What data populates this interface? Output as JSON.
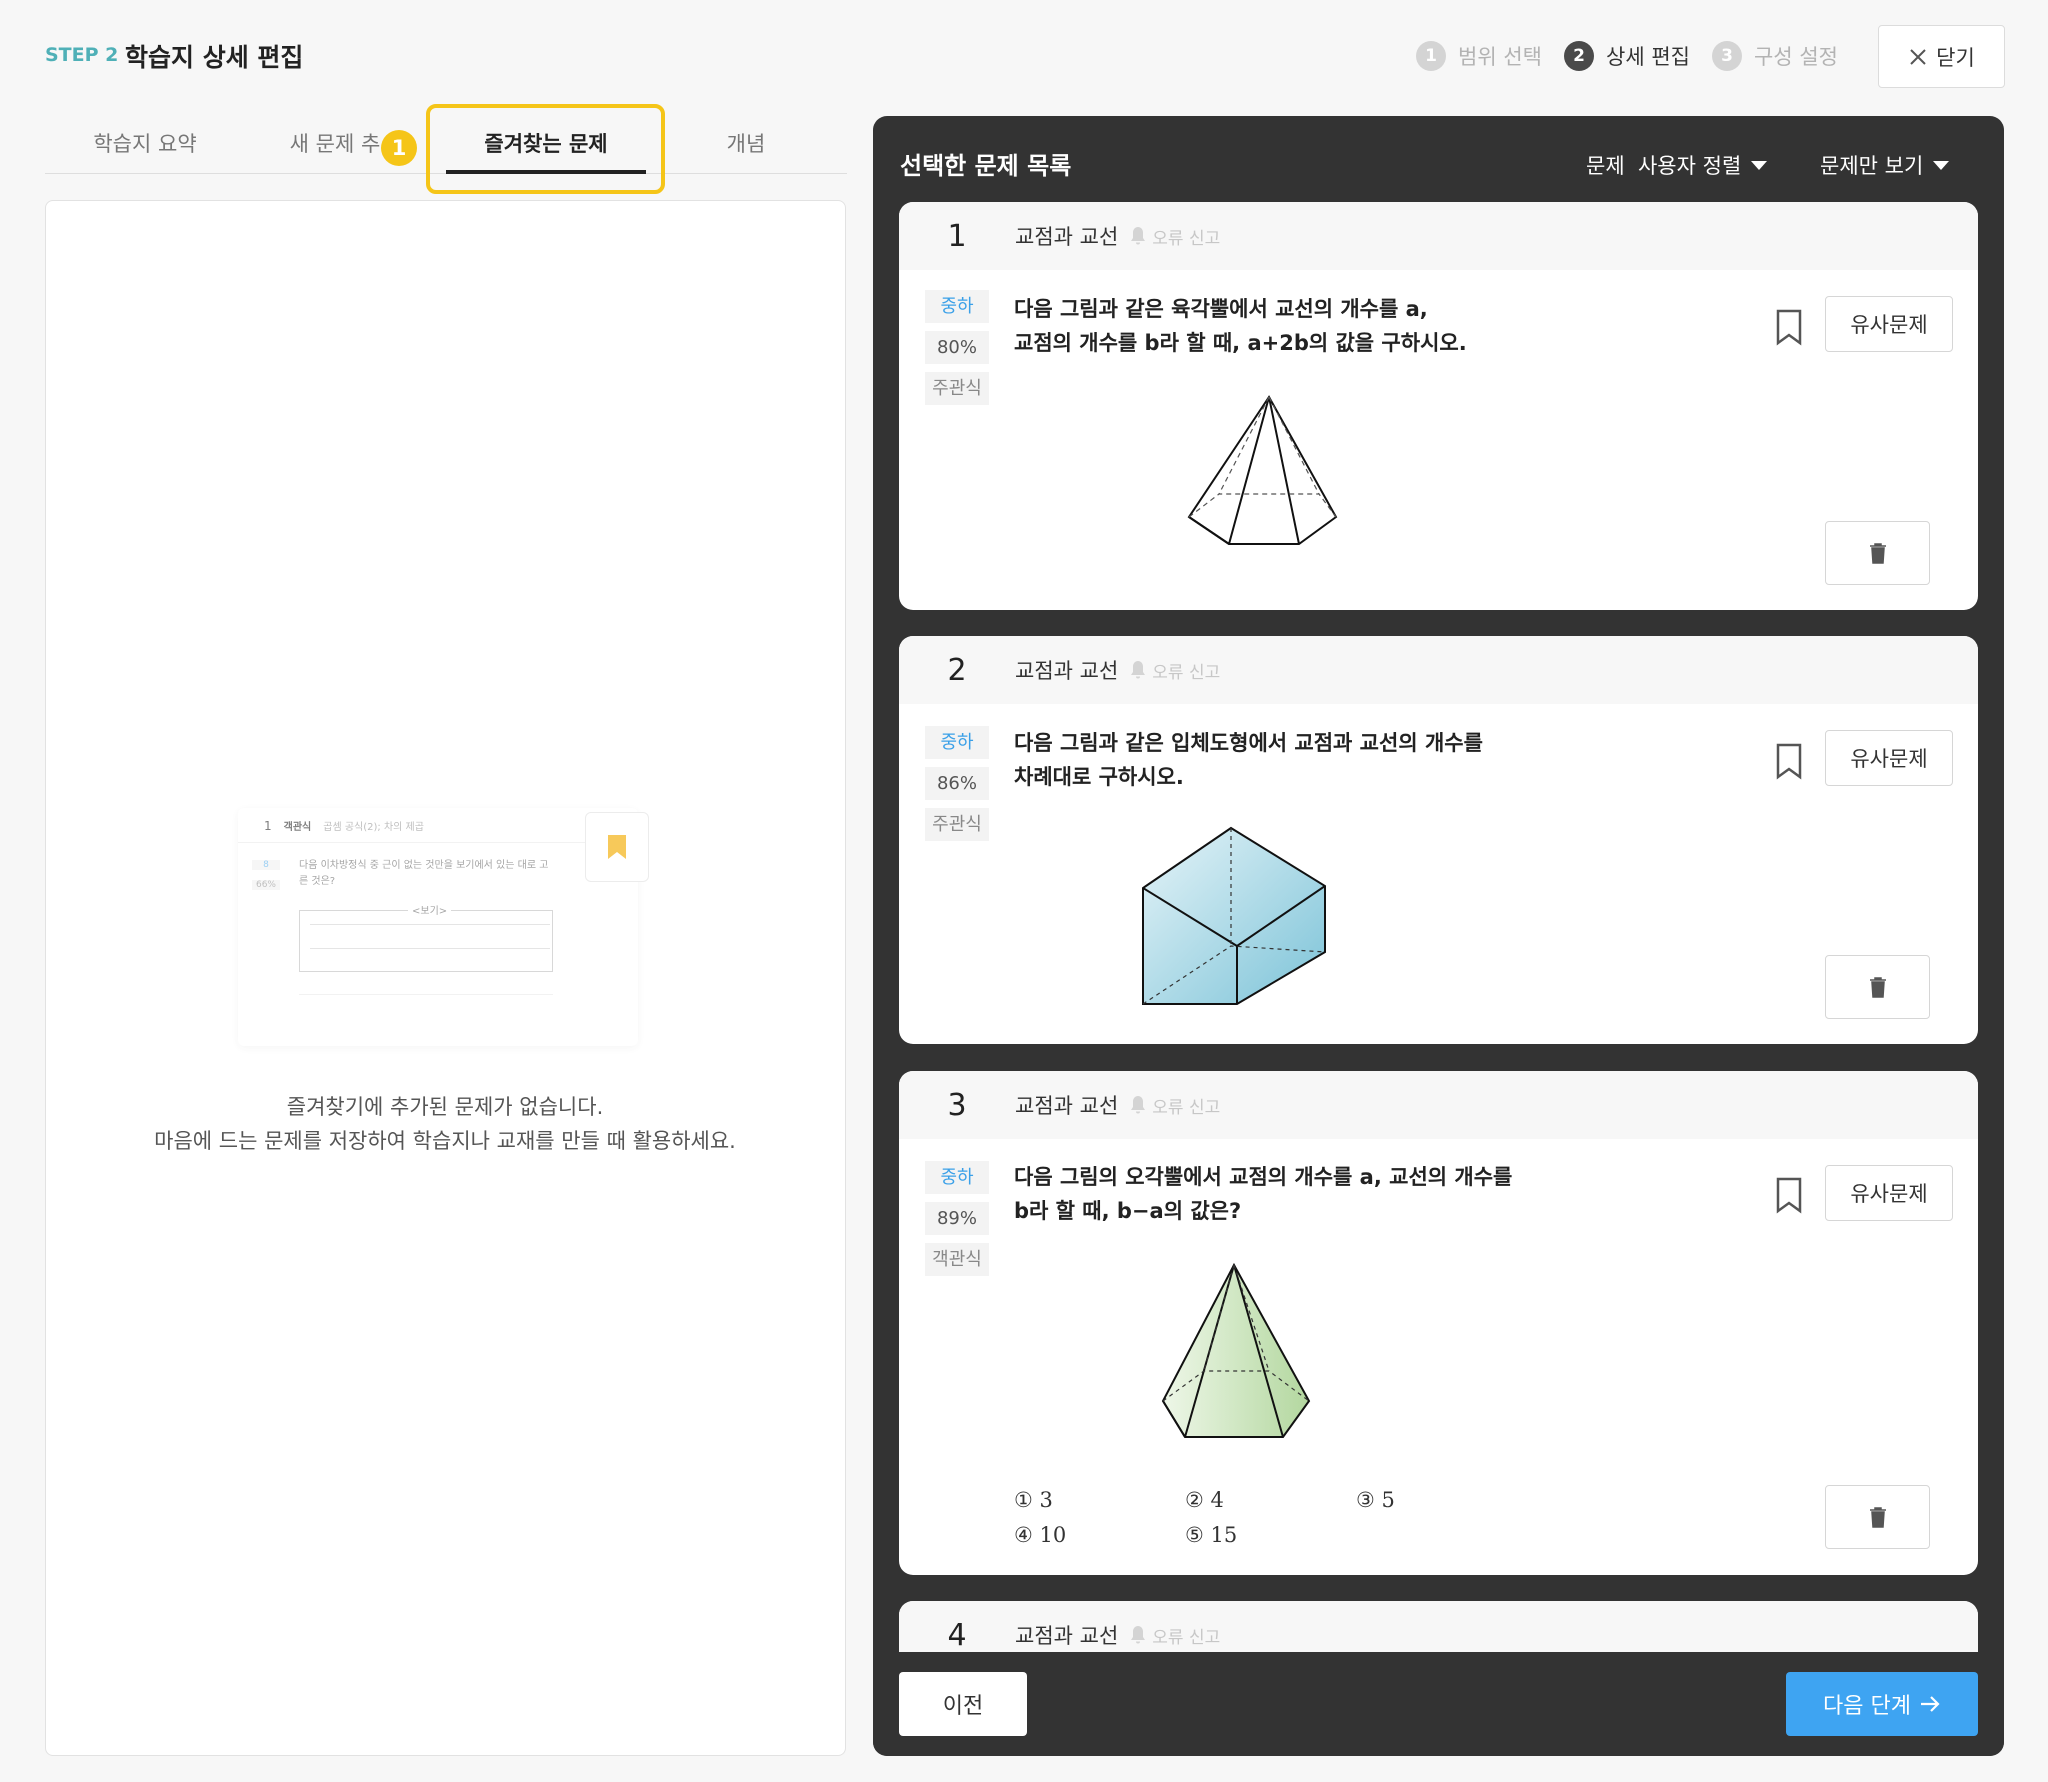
{
  "header": {
    "step_tag": "STEP 2",
    "title": "학습지 상세 편집",
    "steps": [
      {
        "num": "1",
        "label": "범위 선택"
      },
      {
        "num": "2",
        "label": "상세 편집"
      },
      {
        "num": "3",
        "label": "구성 설정"
      }
    ],
    "close_label": "닫기"
  },
  "tabs": [
    {
      "label": "학습지 요약"
    },
    {
      "label": "새 문제 추"
    },
    {
      "label": "즐겨찾는 문제"
    },
    {
      "label": "개념"
    }
  ],
  "annotation_badge": "1",
  "left_panel": {
    "thumb": {
      "num": "1",
      "type": "객관식",
      "topic": "곱셈 공식(2); 차의 제곱",
      "text": "다음 이차방정식 중 근이 없는 것만을 보기에서 있는 대로 고른 것은?",
      "box_title": "<보기>",
      "level": "8",
      "pct": "66%"
    },
    "empty_line1": "즐겨찾기에 추가된 문제가 없습니다.",
    "empty_line2": "마음에 드는 문제를 저장하여 학습지나 교재를 만들 때 활용하세요."
  },
  "right_panel": {
    "title": "선택한 문제 목록",
    "sort_label": "문제  사용자 정렬",
    "view_label": "문제만 보기",
    "report_label": "오류 신고",
    "similar_label": "유사문제",
    "questions": [
      {
        "num": "1",
        "topic": "교점과 교선",
        "level": "중하",
        "pct": "80%",
        "type": "주관식",
        "line1": "다음 그림과 같은 육각뿔에서 교선의 개수를 a,",
        "line2": "교점의 개수를 b라 할 때, a+2b의 값을 구하시오."
      },
      {
        "num": "2",
        "topic": "교점과 교선",
        "level": "중하",
        "pct": "86%",
        "type": "주관식",
        "line1": "다음 그림과 같은 입체도형에서 교점과 교선의 개수를",
        "line2": "차례대로 구하시오."
      },
      {
        "num": "3",
        "topic": "교점과 교선",
        "level": "중하",
        "pct": "89%",
        "type": "객관식",
        "line1": "다음 그림의 오각뿔에서 교점의 개수를 a, 교선의 개수를",
        "line2": "b라 할 때, b−a의 값은?",
        "choices": [
          "① 3",
          "② 4",
          "③ 5",
          "④ 10",
          "⑤ 15"
        ]
      },
      {
        "num": "4",
        "topic": "교점과 교선"
      }
    ],
    "prev_label": "이전",
    "next_label": "다음 단계"
  },
  "colors": {
    "accent_blue": "#3ea4f2",
    "highlight": "#f5c518",
    "panel_dark": "#333333",
    "step_teal": "#4fb0b7"
  }
}
